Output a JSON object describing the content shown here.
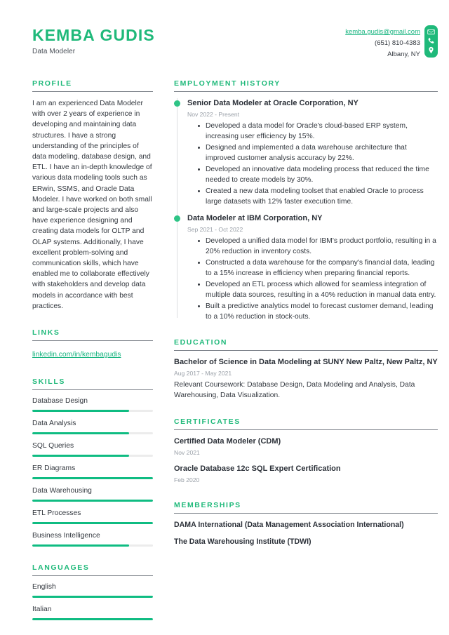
{
  "header": {
    "full_name": "KEMBA GUDIS",
    "job_title": "Data Modeler",
    "contact": {
      "email": "kemba.gudis@gmail.com",
      "phone": "(651) 810-4383",
      "location": "Albany, NY",
      "icons": [
        "envelope-icon",
        "phone-icon",
        "location-pin-icon"
      ]
    }
  },
  "theme": {
    "accent": "#1fb97a",
    "bar_fill": "#0fbc82",
    "bar_track": "#ececec",
    "text": "#33383f",
    "muted": "#9aa0a8"
  },
  "sidebar": {
    "profile": {
      "title": "PROFILE",
      "text": "I am an experienced Data Modeler with over 2 years of experience in developing and maintaining data structures. I have a strong understanding of the principles of data modeling, database design, and ETL. I have an in-depth knowledge of various data modeling tools such as ERwin, SSMS, and Oracle Data Modeler. I have worked on both small and large-scale projects and also have experience designing and creating data models for OLTP and OLAP systems. Additionally, I have excellent problem-solving and communication skills, which have enabled me to collaborate effectively with stakeholders and develop data models in accordance with best practices."
    },
    "links": {
      "title": "LINKS",
      "items": [
        {
          "label": "linkedin.com/in/kembagudis"
        }
      ]
    },
    "skills": {
      "title": "SKILLS",
      "items": [
        {
          "label": "Database Design",
          "level": 80
        },
        {
          "label": "Data Analysis",
          "level": 80
        },
        {
          "label": "SQL Queries",
          "level": 80
        },
        {
          "label": "ER Diagrams",
          "level": 100
        },
        {
          "label": "Data Warehousing",
          "level": 100
        },
        {
          "label": "ETL Processes",
          "level": 100
        },
        {
          "label": "Business Intelligence",
          "level": 80
        }
      ]
    },
    "languages": {
      "title": "LANGUAGES",
      "items": [
        {
          "label": "English",
          "level": 100
        },
        {
          "label": "Italian",
          "level": 100
        }
      ]
    }
  },
  "main": {
    "employment": {
      "title": "EMPLOYMENT HISTORY",
      "jobs": [
        {
          "title": "Senior Data Modeler at Oracle Corporation, NY",
          "date": "Nov 2022 - Present",
          "bullets": [
            "Developed a data model for Oracle's cloud-based ERP system, increasing user efficiency by 15%.",
            "Designed and implemented a data warehouse architecture that improved customer analysis accuracy by 22%.",
            "Developed an innovative data modeling process that reduced the time needed to create models by 30%.",
            "Created a new data modeling toolset that enabled Oracle to process large datasets with 12% faster execution time."
          ]
        },
        {
          "title": "Data Modeler at IBM Corporation, NY",
          "date": "Sep 2021 - Oct 2022",
          "bullets": [
            "Developed a unified data model for IBM's product portfolio, resulting in a 20% reduction in inventory costs.",
            "Constructed a data warehouse for the company's financial data, leading to a 15% increase in efficiency when preparing financial reports.",
            "Developed an ETL process which allowed for seamless integration of multiple data sources, resulting in a 40% reduction in manual data entry.",
            "Built a predictive analytics model to forecast customer demand, leading to a 10% reduction in stock-outs."
          ]
        }
      ]
    },
    "education": {
      "title": "EDUCATION",
      "items": [
        {
          "title": "Bachelor of Science in Data Modeling at SUNY New Paltz, New Paltz, NY",
          "date": "Aug 2017 - May 2021",
          "description": "Relevant Coursework: Database Design, Data Modeling and Analysis, Data Warehousing, Data Visualization."
        }
      ]
    },
    "certificates": {
      "title": "CERTIFICATES",
      "items": [
        {
          "title": "Certified Data Modeler (CDM)",
          "date": "Nov 2021"
        },
        {
          "title": "Oracle Database 12c SQL Expert Certification",
          "date": "Feb 2020"
        }
      ]
    },
    "memberships": {
      "title": "MEMBERSHIPS",
      "items": [
        {
          "title": "DAMA International (Data Management Association International)"
        },
        {
          "title": "The Data Warehousing Institute (TDWI)"
        }
      ]
    }
  }
}
